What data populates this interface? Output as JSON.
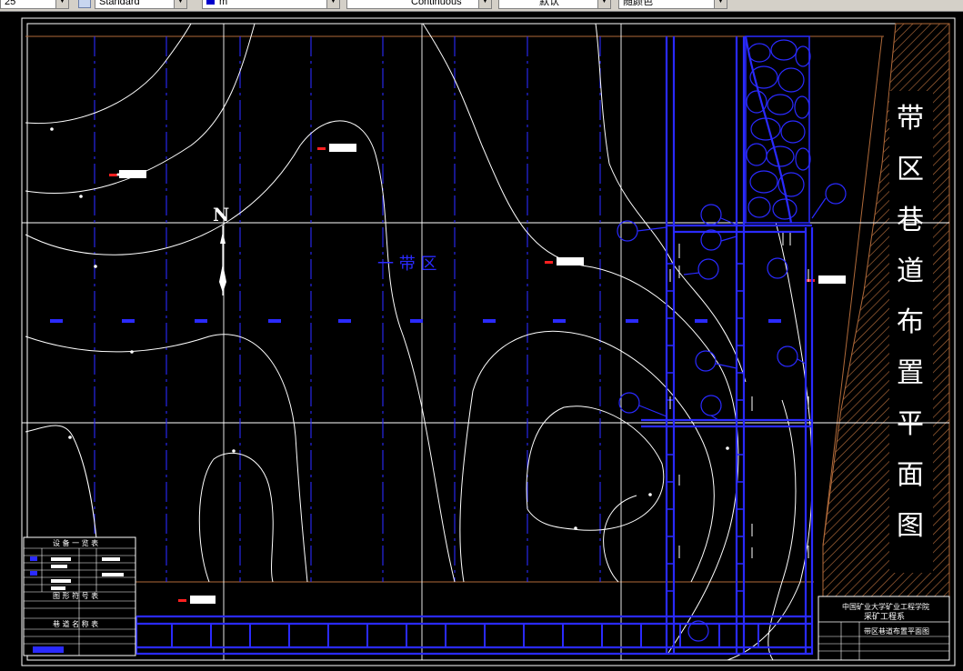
{
  "toolbar": {
    "layer_combo": "25",
    "textstyle_combo": "Standard",
    "color_combo": "m",
    "linetype_combo": "Continuous",
    "lineweight_combo": "默认",
    "plotstyle_combo": "随颜色"
  },
  "drawing": {
    "north_label": "N",
    "area_label": "一 带 区",
    "vertical_title": [
      "带",
      "区",
      "巷",
      "道",
      "布",
      "置",
      "平",
      "面",
      "图"
    ],
    "title_block": {
      "school": "中国矿业大学矿业工程学院",
      "department": "采矿工程系",
      "drawing_name": "带区巷道布置平面图"
    },
    "tables": {
      "equipment": "设 备 一 览 表",
      "symbols": "图 形 符 号 表",
      "roadways": "巷 道 名 称 表"
    }
  },
  "colors": {
    "background": "#000000",
    "contour": "#ffffff",
    "roadway": "#2a2aff",
    "border_brown": "#b06a3a",
    "toolbar": "#d4d0c8"
  }
}
